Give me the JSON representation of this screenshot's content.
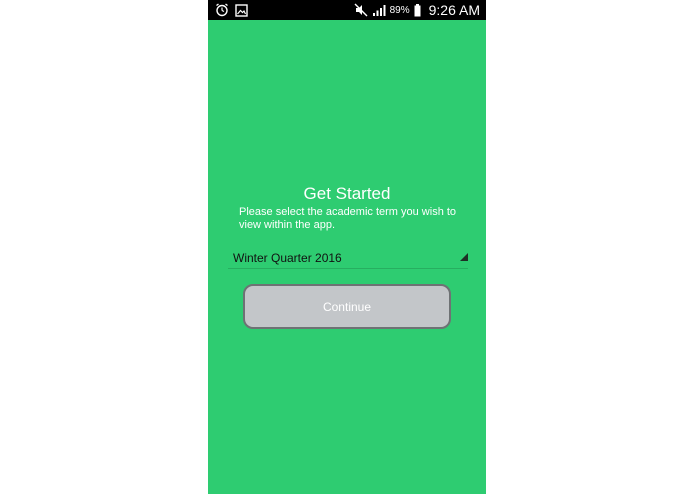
{
  "status_bar": {
    "battery_percent": "89%",
    "time": "9:26 AM",
    "icons": [
      "alarm-clock-icon",
      "image-notification-icon",
      "mute-icon",
      "signal-icon",
      "battery-icon"
    ]
  },
  "onboarding": {
    "title": "Get Started",
    "subtitle": "Please select the academic term you wish to view within the app.",
    "term_select": {
      "selected_value": "Winter Quarter 2016"
    },
    "continue_label": "Continue"
  },
  "colors": {
    "background": "#2ecc71",
    "button_fill": "#c3c6c9",
    "button_border": "#6e7274",
    "status_bar": "#000000"
  }
}
